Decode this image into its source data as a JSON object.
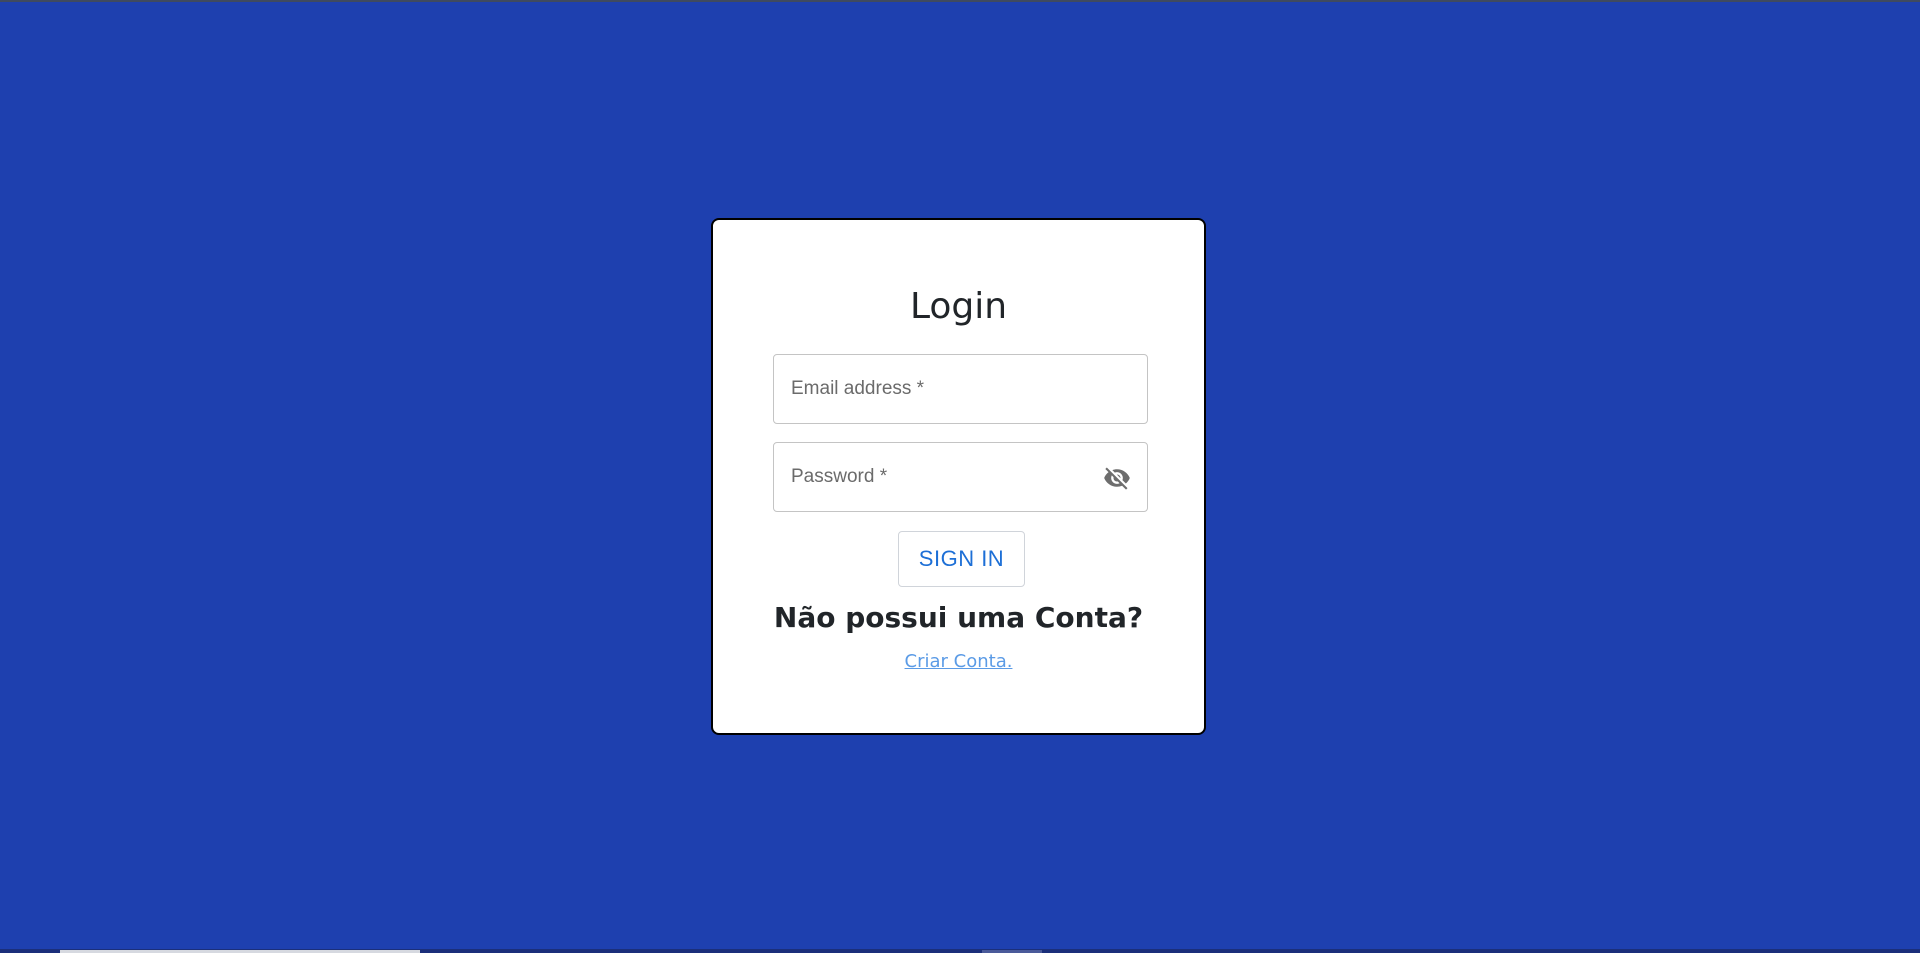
{
  "colors": {
    "background": "#1e40af",
    "card": "#ffffff",
    "accent": "#1d6fd6",
    "link": "#5b9be6"
  },
  "login": {
    "title": "Login",
    "email": {
      "label": "Email address *",
      "value": ""
    },
    "password": {
      "label": "Password *",
      "value": "",
      "toggle_icon": "eye-off-icon"
    },
    "sign_in_label": "SIGN IN",
    "no_account_text": "Não possui uma Conta?",
    "create_account_link": "Criar Conta."
  }
}
